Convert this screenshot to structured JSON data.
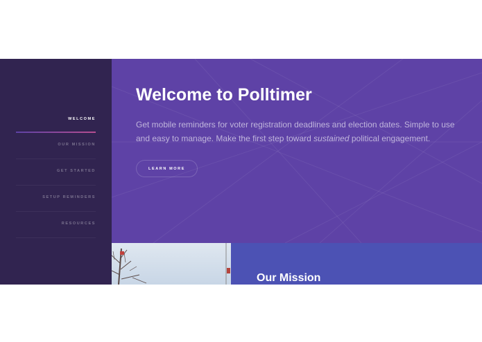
{
  "sidebar": {
    "items": [
      {
        "label": "Welcome",
        "active": true
      },
      {
        "label": "Our Mission",
        "active": false
      },
      {
        "label": "Get Started",
        "active": false
      },
      {
        "label": "Setup Reminders",
        "active": false
      },
      {
        "label": "Resources",
        "active": false
      }
    ]
  },
  "hero": {
    "title": "Welcome to Polltimer",
    "text_before": "Get mobile reminders for voter registration deadlines and election dates. Simple to use and easy to manage. Make the first step toward ",
    "text_emphasis": "sustained",
    "text_after": " political engagement.",
    "button_label": "Learn More"
  },
  "mission": {
    "title": "Our Mission"
  },
  "colors": {
    "sidebar_bg": "#312450",
    "hero_bg": "#5e42a6",
    "mission_bg": "#4c52b4",
    "accent_gradient_start": "#5e42a6",
    "accent_gradient_end": "#b74e91"
  }
}
